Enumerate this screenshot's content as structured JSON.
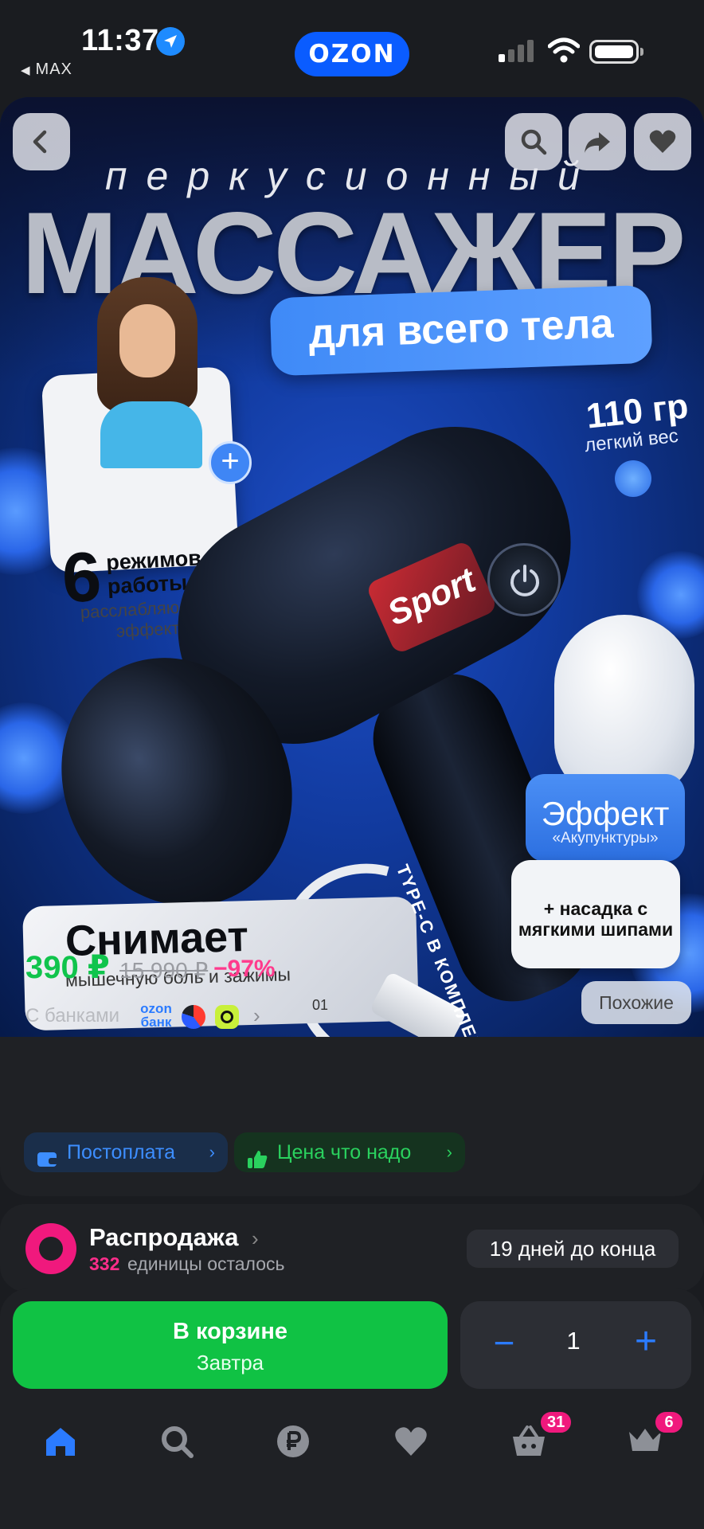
{
  "status_bar": {
    "time": "11:37",
    "back_app": "MAX",
    "brand": "OZON"
  },
  "product_image": {
    "overline": "перкусионный",
    "headline": "МАССАЖЕР",
    "pill": "для всего тела",
    "weight": "110 гр",
    "weight_sub": "легкий вес",
    "modes_number": "6",
    "modes_title": "режимов работы",
    "modes_sub": "расслабляющий эффект",
    "device_label": "Sport",
    "effect_title": "Эффект",
    "effect_sub": "«Акупунктуры»",
    "attachment_text": "+ насадка с мягкими шипами",
    "relieves_title": "Снимает",
    "relieves_sub": "мышечную боль и зажимы",
    "relieves_num": "01",
    "typec_label": "TYPE-C В КОМПЛЕКТЕ",
    "similar_button": "Похожие"
  },
  "price": {
    "current": "390 ₽",
    "old": "15 990 ₽",
    "discount": "−97%",
    "banks_label": "С банками",
    "ozon_bank": "ozon банк"
  },
  "tags": {
    "postpay": "Постоплата",
    "good_price": "Цена что надо"
  },
  "sale": {
    "title": "Распродажа",
    "count": "332",
    "left_label": "единицы осталось",
    "timer": "19 дней до конца"
  },
  "cart": {
    "title": "В корзине",
    "delivery": "Завтра",
    "quantity": "1",
    "minus": "−",
    "plus": "+"
  },
  "tabbar": {
    "cart_badge": "31",
    "profile_badge": "6"
  },
  "colors": {
    "accent_green": "#10c244",
    "accent_blue": "#2b7bff",
    "accent_pink": "#f0197d"
  }
}
